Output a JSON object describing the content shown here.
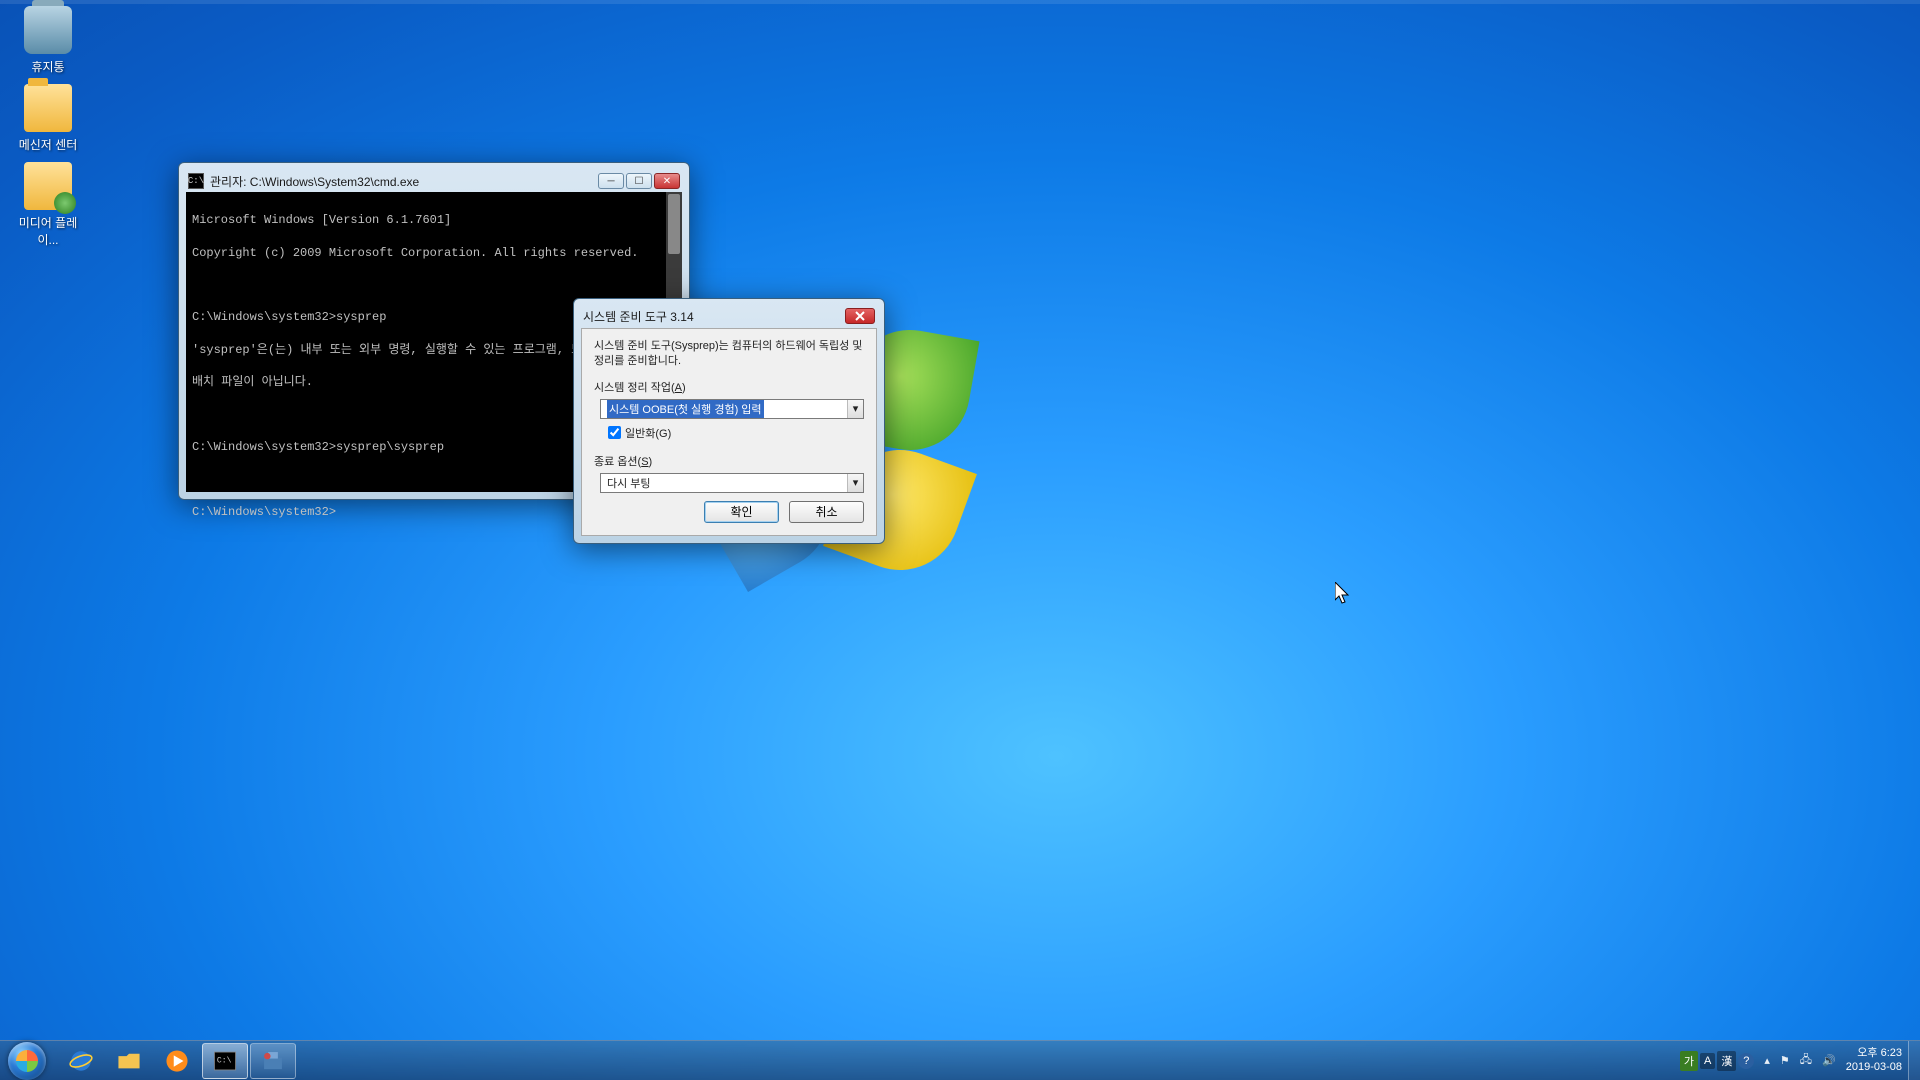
{
  "desktop": {
    "icons": [
      {
        "name": "휴지통"
      },
      {
        "name": "메신저 센터"
      },
      {
        "name": "미디어 플레이..."
      }
    ]
  },
  "cmd": {
    "title": "관리자: C:\\Windows\\System32\\cmd.exe",
    "icon_text": "C:\\",
    "lines": {
      "l0": "Microsoft Windows [Version 6.1.7601]",
      "l1": "Copyright (c) 2009 Microsoft Corporation. All rights reserved.",
      "l2": "",
      "l3": "C:\\Windows\\system32>sysprep",
      "l4": "'sysprep'은(는) 내부 또는 외부 명령, 실행할 수 있는 프로그램, 또는",
      "l5": "배치 파일이 아닙니다.",
      "l6": "",
      "l7": "C:\\Windows\\system32>sysprep\\sysprep",
      "l8": "",
      "l9": "C:\\Windows\\system32>"
    }
  },
  "sysprep": {
    "title": "시스템 준비 도구 3.14",
    "description": "시스템 준비 도구(Sysprep)는 컴퓨터의 하드웨어 독립성 및 정리를 준비합니다.",
    "cleanup_label": "시스템 정리 작업(",
    "cleanup_accel": "A",
    "cleanup_label_end": ")",
    "cleanup_value": "시스템 OOBE(첫 실행 경험) 입력",
    "generalize_label": "일반화(",
    "generalize_accel": "G",
    "generalize_label_end": ")",
    "generalize_checked": true,
    "shutdown_label": "종료 옵션(",
    "shutdown_accel": "S",
    "shutdown_label_end": ")",
    "shutdown_value": "다시 부팅",
    "ok": "확인",
    "cancel": "취소"
  },
  "taskbar": {
    "lang": {
      "ime": "가",
      "input": "A",
      "hanja": "漢",
      "help": "?"
    },
    "time": "오후 6:23",
    "date": "2019-03-08"
  }
}
